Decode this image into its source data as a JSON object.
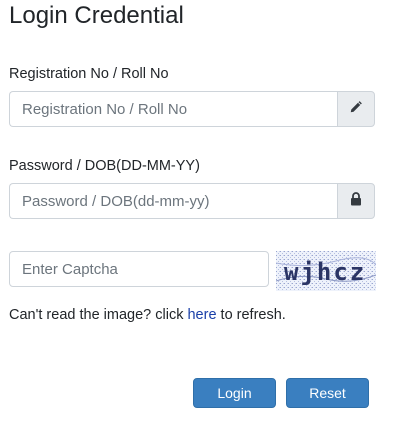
{
  "title": "Login Credential",
  "registration": {
    "label": "Registration No / Roll No",
    "placeholder": "Registration No / Roll No",
    "value": "",
    "icon": "pencil-icon"
  },
  "password": {
    "label": "Password / DOB(DD-MM-YY)",
    "placeholder": "Password / DOB(dd-mm-yy)",
    "value": "",
    "icon": "lock-icon"
  },
  "captcha": {
    "placeholder": "Enter Captcha",
    "value": "",
    "image_text": "wjhcz"
  },
  "help": {
    "prefix": "Can't read the image? click",
    "link": "here",
    "suffix": "to refresh."
  },
  "buttons": {
    "login": "Login",
    "reset": "Reset"
  },
  "colors": {
    "button": "#3a7fc0",
    "link": "#1a3fa8",
    "addon_bg": "#e9ecef"
  }
}
